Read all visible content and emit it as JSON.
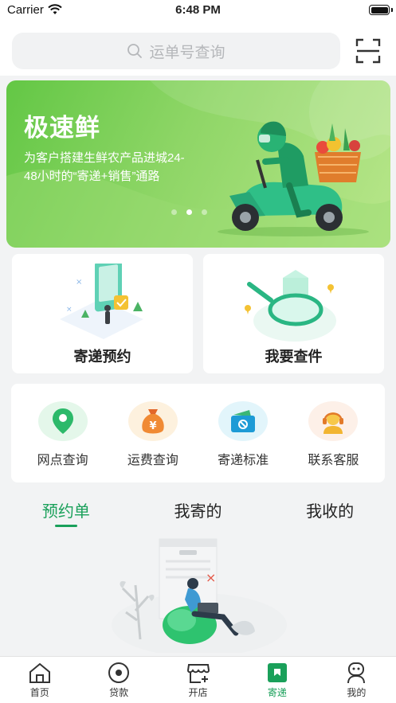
{
  "status_bar": {
    "carrier": "Carrier",
    "time": "6:48 PM"
  },
  "search": {
    "placeholder": "运单号查询"
  },
  "banner": {
    "title": "极速鲜",
    "description": "为客户搭建生鲜农产品进城24-48小时的“寄递+销售”通路",
    "active_slide": 2,
    "slide_count": 3
  },
  "cards": {
    "book_label": "寄递预约",
    "query_label": "我要查件"
  },
  "services": [
    {
      "label": "网点查询",
      "icon": "location-pin-icon"
    },
    {
      "label": "运费查询",
      "icon": "money-bag-icon"
    },
    {
      "label": "寄递标准",
      "icon": "wallet-icon"
    },
    {
      "label": "联系客服",
      "icon": "customer-service-icon"
    }
  ],
  "tabs": [
    {
      "label": "预约单",
      "active": true
    },
    {
      "label": "我寄的",
      "active": false
    },
    {
      "label": "我收的",
      "active": false
    }
  ],
  "tabbar": [
    {
      "label": "首页",
      "icon": "home-icon",
      "active": false
    },
    {
      "label": "贷款",
      "icon": "loan-icon",
      "active": false
    },
    {
      "label": "开店",
      "icon": "store-icon",
      "active": false
    },
    {
      "label": "寄递",
      "icon": "send-box-icon",
      "active": true
    },
    {
      "label": "我的",
      "icon": "profile-icon",
      "active": false
    }
  ],
  "colors": {
    "accent": "#1aa05a",
    "banner": "#7bd055",
    "page_bg": "#f2f3f4"
  }
}
